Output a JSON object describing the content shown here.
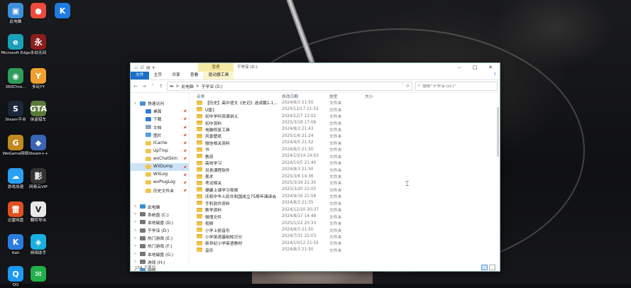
{
  "desktop": {
    "icons": [
      {
        "label": "此电脑",
        "glyph": "▣",
        "color": "#3d8fd9"
      },
      {
        "label": "",
        "glyph": "●",
        "color": "#e94b3c"
      },
      {
        "label": "",
        "glyph": "K",
        "color": "#1e7ce0"
      },
      {
        "label": "Microsoft Edge",
        "glyph": "e",
        "color": "#1aa0b8"
      },
      {
        "label": "永劫无间",
        "glyph": "永",
        "color": "#8a1e1e"
      },
      {
        "label": "360Chro...",
        "glyph": "◉",
        "color": "#2e9c5a"
      },
      {
        "label": "多玩YY",
        "glyph": "Y",
        "color": "#f0a030"
      },
      {
        "label": "Steam平台",
        "glyph": "S",
        "color": "#1b2838"
      },
      {
        "label": "侠盗猎车",
        "glyph": "GTA",
        "color": "#5a7a3a"
      },
      {
        "label": "WeGame网络",
        "glyph": "G",
        "color": "#c08a20"
      },
      {
        "label": "Steam++",
        "glyph": "◆",
        "color": "#3a64b4"
      },
      {
        "label": "游戏加速",
        "glyph": "☁",
        "color": "#2aa0f0"
      },
      {
        "label": "网易云VIP",
        "glyph": "影",
        "color": "#333333"
      },
      {
        "label": "迅雷网盘",
        "glyph": "雷",
        "color": "#e0501e"
      },
      {
        "label": "翻转导出",
        "glyph": "V",
        "color": "#e8e8e8"
      },
      {
        "label": "Kali",
        "glyph": "K",
        "color": "#2a7de0"
      },
      {
        "label": "网络助手",
        "glyph": "◈",
        "color": "#18b0e0"
      },
      {
        "label": "QQ",
        "glyph": "Q",
        "color": "#1a9af0"
      },
      {
        "label": "",
        "glyph": "✉",
        "color": "#21b04a"
      }
    ]
  },
  "window": {
    "title": "于学深 (D:)",
    "context_tab": "管理",
    "ribbon_tabs": [
      "文件",
      "主页",
      "共享",
      "查看",
      "驱动器工具"
    ],
    "address": {
      "root": "此电脑",
      "sep": ">",
      "current": "于学深 (D:)"
    },
    "search_placeholder": "搜索\"于学深 (D:)\"",
    "columns": {
      "name": "名称",
      "date": "修改日期",
      "type": "类型",
      "size": "大小"
    },
    "nav_items": [
      {
        "label": "快速访问",
        "chev": "v",
        "color": "#4a90d9",
        "indent": 0,
        "pin": false
      },
      {
        "label": "桌面",
        "chev": "",
        "color": "#2e7bd6",
        "indent": 1,
        "pin": true
      },
      {
        "label": "下载",
        "chev": "",
        "color": "#2e7bd6",
        "indent": 1,
        "pin": true
      },
      {
        "label": "文档",
        "chev": "",
        "color": "#8aa4c8",
        "indent": 1,
        "pin": true
      },
      {
        "label": "图片",
        "chev": "",
        "color": "#4aa0e0",
        "indent": 1,
        "pin": true
      },
      {
        "label": "ICache",
        "chev": "",
        "color": "#f2c54b",
        "indent": 1,
        "pin": true
      },
      {
        "label": "UpTmp",
        "chev": "",
        "color": "#f2c54b",
        "indent": 1,
        "pin": true
      },
      {
        "label": "wxChatSkin",
        "chev": "",
        "color": "#f2c54b",
        "indent": 1,
        "pin": true
      },
      {
        "label": "WXDump",
        "chev": "",
        "color": "#f2c54b",
        "indent": 1,
        "pin": true,
        "selected": true
      },
      {
        "label": "WXLog",
        "chev": "",
        "color": "#f2c54b",
        "indent": 1,
        "pin": true
      },
      {
        "label": "wxPlugLog",
        "chev": "",
        "color": "#f2c54b",
        "indent": 1,
        "pin": true
      },
      {
        "label": "历史文件夹",
        "chev": "",
        "color": "#f2c54b",
        "indent": 1,
        "pin": true
      },
      {
        "label": "",
        "chev": "",
        "color": "transparent",
        "indent": 0,
        "pin": false
      },
      {
        "label": "此电脑",
        "chev": ">",
        "color": "#3d8fd9",
        "indent": 0,
        "pin": false
      },
      {
        "label": "系统盘 (C:)",
        "chev": ">",
        "color": "#777777",
        "indent": 0,
        "pin": false
      },
      {
        "label": "本地磁盘 (D:)",
        "chev": ">",
        "color": "#777777",
        "indent": 0,
        "pin": false
      },
      {
        "label": "于学深 (D:)",
        "chev": ">",
        "color": "#777777",
        "indent": 0,
        "pin": false
      },
      {
        "label": "热门游戏 (E:)",
        "chev": ">",
        "color": "#777777",
        "indent": 0,
        "pin": false
      },
      {
        "label": "热门游戏 (F:)",
        "chev": ">",
        "color": "#777777",
        "indent": 0,
        "pin": false
      },
      {
        "label": "本地磁盘 (G:)",
        "chev": ">",
        "color": "#777777",
        "indent": 0,
        "pin": false
      },
      {
        "label": "游戏 (H:)",
        "chev": ">",
        "color": "#777777",
        "indent": 0,
        "pin": false
      },
      {
        "label": "网络",
        "chev": ">",
        "color": "#4a90d9",
        "indent": 0,
        "pin": false
      }
    ],
    "files": [
      {
        "name": "【历史】高中语文《史记》选读篇1-1...",
        "date": "2024/8/3 21:50",
        "type": "文件夹"
      },
      {
        "name": "U盘1",
        "date": "2024/12/17 21:52",
        "type": "文件夹"
      },
      {
        "name": "初中学科资源讲义",
        "date": "2024/12/7 12:02",
        "type": "文件夹"
      },
      {
        "name": "初中资料",
        "date": "2025/3/18 17:08",
        "type": "文件夹"
      },
      {
        "name": "电脑修复工具",
        "date": "2024/8/3 21:43",
        "type": "文件夹"
      },
      {
        "name": "风景壁纸",
        "date": "2025/1/6 21:24",
        "type": "文件夹"
      },
      {
        "name": "微信相关资料",
        "date": "2024/4/5 21:52",
        "type": "文件夹"
      },
      {
        "name": "书",
        "date": "2024/8/3 21:50",
        "type": "文件夹"
      },
      {
        "name": "教资",
        "date": "2024/10/14 14:03",
        "type": "文件夹"
      },
      {
        "name": "高效学习",
        "date": "2024/10/5 21:40",
        "type": "文件夹"
      },
      {
        "name": "另类课程软件",
        "date": "2024/8/3 21:50",
        "type": "文件夹"
      },
      {
        "name": "美术",
        "date": "2025/3/6 14:36",
        "type": "文件夹"
      },
      {
        "name": "考试相关",
        "date": "2025/3/19 21:30",
        "type": "文件夹"
      },
      {
        "name": "健康上课学习视频",
        "date": "2025/3/20 21:05",
        "type": "文件夹"
      },
      {
        "name": "庆祝中华人民共和国成立75周年演讲会",
        "date": "2024/9/16 21:58",
        "type": "文件夹"
      },
      {
        "name": "手机软件资料",
        "date": "2024/8/3 21:55",
        "type": "文件夹"
      },
      {
        "name": "数学资料",
        "date": "2024/12/20 20:37",
        "type": "文件夹"
      },
      {
        "name": "微博文件",
        "date": "2024/8/17 14:48",
        "type": "文件夹"
      },
      {
        "name": "视频",
        "date": "2025/1/22 20:33",
        "type": "文件夹"
      },
      {
        "name": "小学上册音乐",
        "date": "2024/8/3 21:50",
        "type": "文件夹"
      },
      {
        "name": "小学英语基础知识分",
        "date": "2024/7/31 22:03",
        "type": "文件夹"
      },
      {
        "name": "新世纪小学英语教材",
        "date": "2024/10/12 21:55",
        "type": "文件夹"
      },
      {
        "name": "音乐",
        "date": "2024/8/3 21:50",
        "type": "文件夹"
      }
    ],
    "status": "154 个项目"
  }
}
